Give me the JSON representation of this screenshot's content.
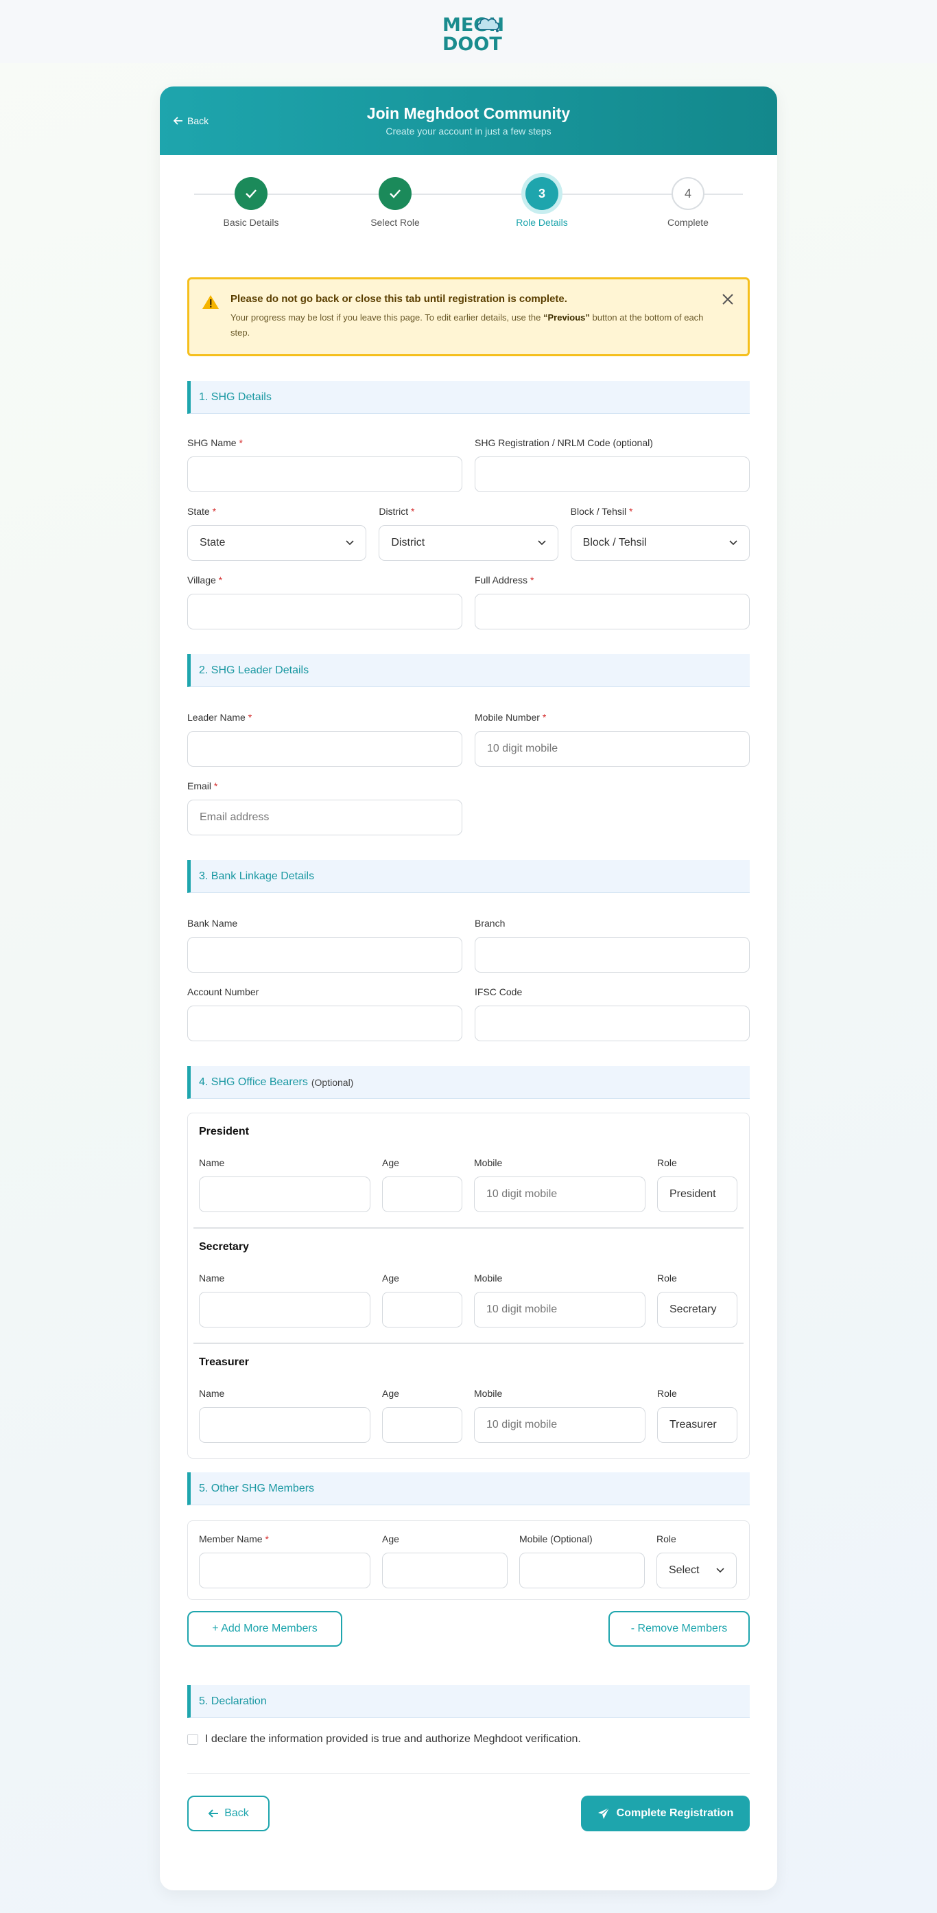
{
  "logo": {
    "line1": "MEGH",
    "line2": "DOOT"
  },
  "header": {
    "back_label": "Back",
    "title": "Join Meghdoot Community",
    "subtitle": "Create your account in just a few steps"
  },
  "stepper": {
    "steps": [
      {
        "number": "1",
        "label": "Basic Details",
        "state": "done"
      },
      {
        "number": "2",
        "label": "Select Role",
        "state": "done"
      },
      {
        "number": "3",
        "label": "Role Details",
        "state": "active"
      },
      {
        "number": "4",
        "label": "Complete",
        "state": "todo"
      }
    ]
  },
  "warning": {
    "title": "Please do not go back or close this tab until registration is complete.",
    "body_prefix": "Your progress may be lost if you leave this page. To edit earlier details, use the ",
    "body_bold": "“Previous”",
    "body_suffix": " button at the bottom of each step.",
    "icon": "warning-triangle-icon",
    "close_icon": "close-icon"
  },
  "shg_details": {
    "section_title": "1. SHG Details",
    "shg_name_label": "SHG Name",
    "reg_code_label": "SHG Registration / NRLM Code (optional)",
    "state_label": "State",
    "state_value": "State",
    "district_label": "District",
    "district_value": "District",
    "block_label": "Block / Tehsil",
    "block_value": "Block / Tehsil",
    "village_label": "Village",
    "address_label": "Full Address",
    "required_mark": "*"
  },
  "leader": {
    "section_title": "2. SHG Leader Details",
    "name_label": "Leader Name",
    "mobile_label": "Mobile Number",
    "mobile_placeholder": "10 digit mobile",
    "email_label": "Email",
    "email_placeholder": "Email address"
  },
  "bank": {
    "section_title": "3. Bank Linkage Details",
    "bank_name_label": "Bank Name",
    "branch_label": "Branch",
    "account_label": "Account Number",
    "ifsc_label": "IFSC Code"
  },
  "bearers": {
    "section_title": "4. SHG Office Bearers",
    "section_optional": "(Optional)",
    "name_label": "Name",
    "age_label": "Age",
    "mobile_label": "Mobile",
    "role_label": "Role",
    "mobile_placeholder": "10 digit mobile",
    "items": [
      {
        "heading": "President",
        "role": "President"
      },
      {
        "heading": "Secretary",
        "role": "Secretary"
      },
      {
        "heading": "Treasurer",
        "role": "Treasurer"
      }
    ]
  },
  "members": {
    "section_title": "5. Other SHG Members",
    "name_label": "Member Name",
    "age_label": "Age",
    "mobile_label": "Mobile (Optional)",
    "role_label": "Role",
    "role_value": "Select",
    "add_label": "+ Add More Members",
    "remove_label": "- Remove Members"
  },
  "declaration": {
    "section_title": "5. Declaration",
    "text": "I declare the information provided is true and authorize Meghdoot verification."
  },
  "footer": {
    "back_label": "Back",
    "submit_label": "Complete Registration"
  },
  "colors": {
    "accent": "#1ea5ad",
    "done": "#1b8a5a",
    "warning_border": "#f5bf1c",
    "required": "#d42c2c"
  }
}
